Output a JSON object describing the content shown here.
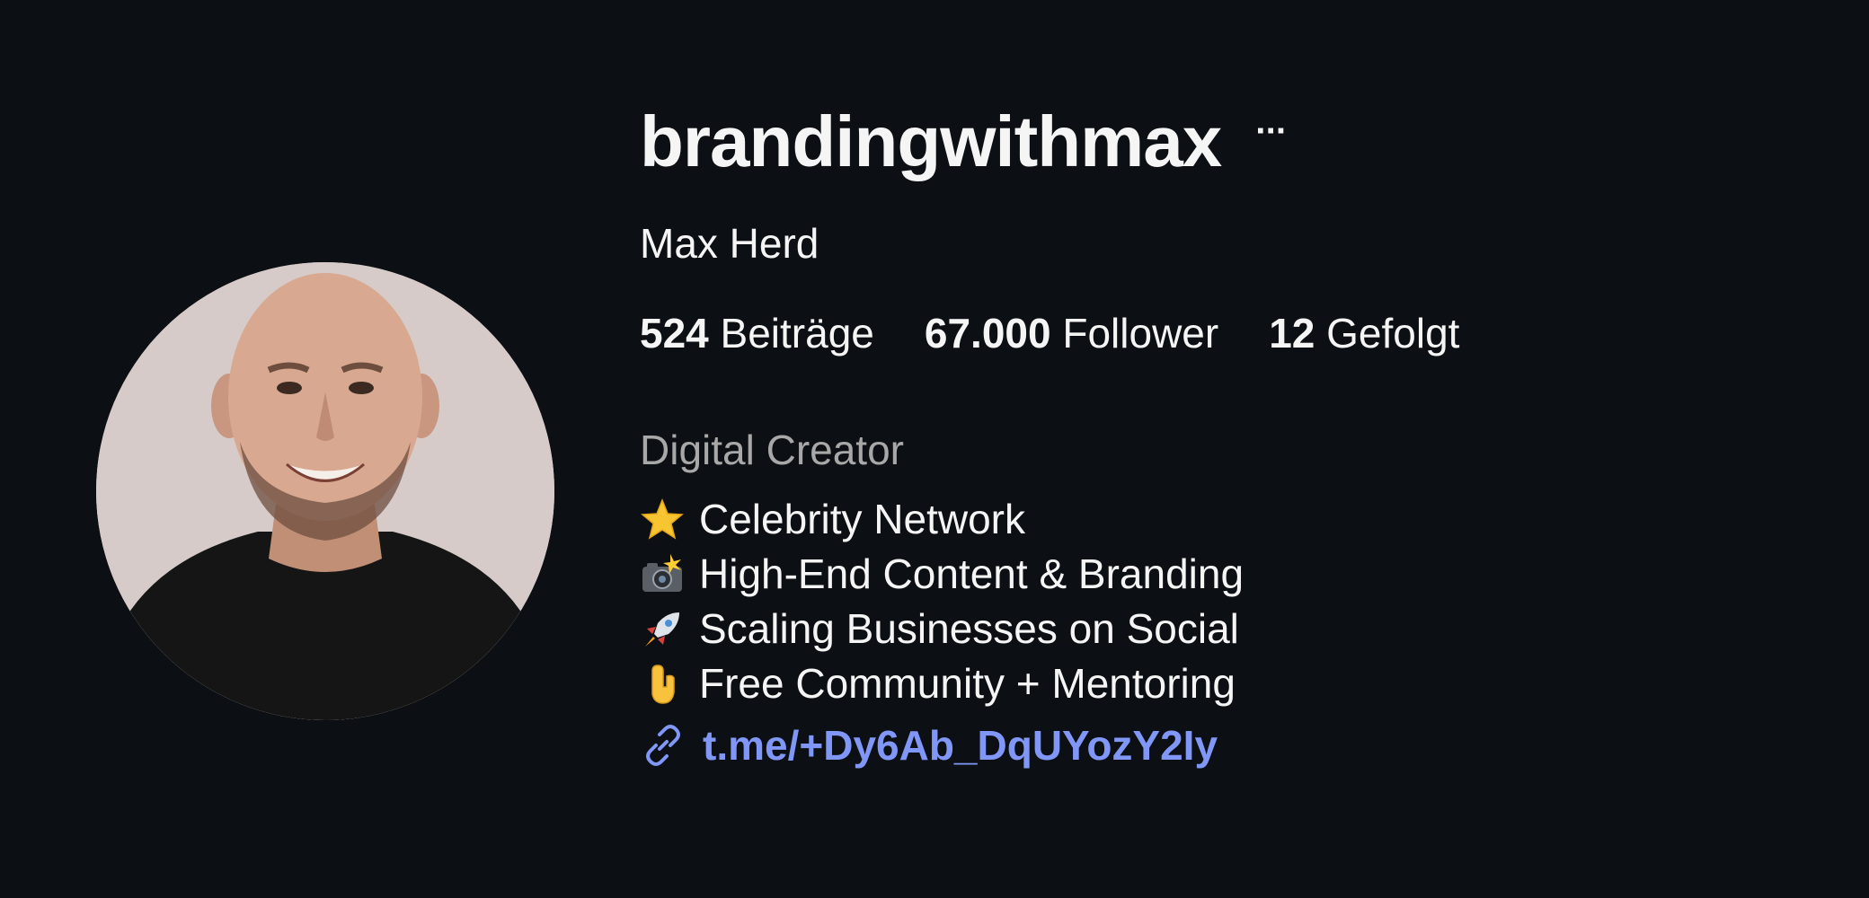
{
  "profile": {
    "username": "brandingwithmax",
    "more_label": "···",
    "full_name": "Max Herd",
    "stats": {
      "posts_count": "524",
      "posts_label": "Beiträge",
      "followers_count": "67.000",
      "followers_label": "Follower",
      "following_count": "12",
      "following_label": "Gefolgt"
    },
    "category": "Digital Creator",
    "bio": [
      {
        "icon": "star-icon",
        "text": "Celebrity Network"
      },
      {
        "icon": "camera-flash-icon",
        "text": "High-End Content & Branding"
      },
      {
        "icon": "rocket-icon",
        "text": "Scaling Businesses on Social"
      },
      {
        "icon": "pointing-down-icon",
        "text": "Free Community + Mentoring"
      }
    ],
    "link": {
      "icon": "link-icon",
      "text": "t.me/+Dy6Ab_DqUYozY2Iy"
    }
  },
  "colors": {
    "background": "#0c1014",
    "text": "#f5f5f5",
    "secondary_text": "#a8a8a8",
    "link": "#8197f7"
  }
}
